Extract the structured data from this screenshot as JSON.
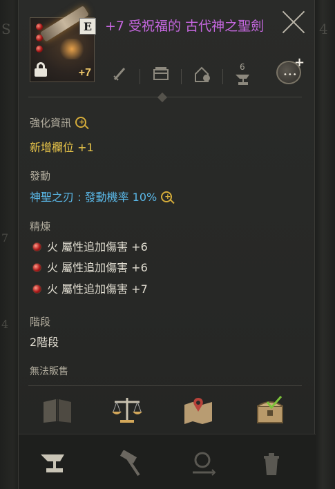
{
  "item": {
    "title": "+7 受祝福的 古代神之聖劍",
    "grade": "E",
    "enhance_level": "+7",
    "sockets": 3,
    "locked": true
  },
  "toolbar": {
    "icons": [
      "sword-icon",
      "chest-icon",
      "house-icon",
      "anvil-icon"
    ],
    "anvil_count": "6"
  },
  "sections": {
    "enhance_info_label": "強化資訊",
    "new_slot_text": "新增欄位 +1",
    "activation_label": "發動",
    "activation_text": "神聖之刃 : 發動機率 10%",
    "refine_label": "精煉",
    "refine_lines": [
      "火 屬性追加傷害 +6",
      "火 屬性追加傷害 +6",
      "火 屬性追加傷害 +7"
    ],
    "tier_label": "階段",
    "tier_value": "2階段",
    "sell_status": "無法販售"
  },
  "actions": [
    "book-icon",
    "scales-icon",
    "map-icon",
    "treasure-chest-icon"
  ],
  "bottom_actions": [
    "anvil-icon",
    "hammer-icon",
    "magnifier-swap-icon",
    "trash-icon"
  ],
  "background": {
    "left_glyphs": [
      "S",
      "7",
      "4"
    ],
    "right_glyph": "4"
  },
  "colors": {
    "title": "#c667e0",
    "yellow": "#e9c64a",
    "blue": "#5ab8e8"
  }
}
